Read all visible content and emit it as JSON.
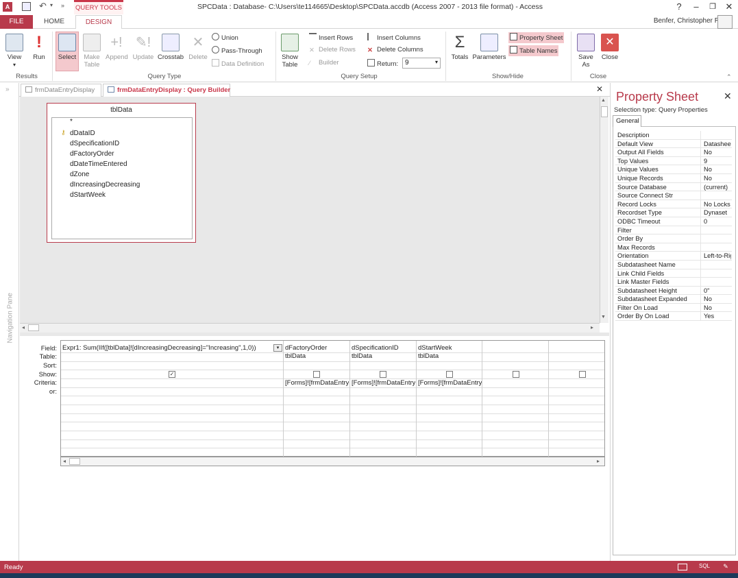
{
  "window": {
    "title": "SPCData : Database- C:\\Users\\te114665\\Desktop\\SPCData.accdb (Access 2007 - 2013 file format) - Access",
    "contextual_tab": "QUERY TOOLS",
    "user": "Benfer, Christopher R",
    "help": "?",
    "min": "–",
    "restore": "❐",
    "close": "✕"
  },
  "tabs": {
    "file": "FILE",
    "home": "HOME",
    "design": "DESIGN"
  },
  "ribbon": {
    "results": {
      "label": "Results",
      "view": "View",
      "run": "Run"
    },
    "query_type": {
      "label": "Query Type",
      "select": "Select",
      "make_table": "Make Table",
      "append": "Append",
      "update": "Update",
      "crosstab": "Crosstab",
      "delete": "Delete",
      "union": "Union",
      "pass_through": "Pass-Through",
      "data_definition": "Data Definition"
    },
    "query_setup": {
      "label": "Query Setup",
      "show_table": "Show Table",
      "insert_rows": "Insert Rows",
      "delete_rows": "Delete Rows",
      "builder": "Builder",
      "insert_columns": "Insert Columns",
      "delete_columns": "Delete Columns",
      "return_label": "Return:",
      "return_value": "9"
    },
    "show_hide": {
      "label": "Show/Hide",
      "totals": "Totals",
      "parameters": "Parameters",
      "property_sheet": "Property Sheet",
      "table_names": "Table Names"
    },
    "close": {
      "label": "Close",
      "save_as": "Save As",
      "close": "Close"
    }
  },
  "doc_tabs": [
    {
      "label": "frmDataEntryDisplay"
    },
    {
      "label": "frmDataEntryDisplay : Query Builder"
    }
  ],
  "nav_pane": {
    "label": "Navigation Pane"
  },
  "table": {
    "name": "tblData",
    "fields": [
      "*",
      "dDataID",
      "dSpecificationID",
      "dFactoryOrder",
      "dDateTimeEntered",
      "dZone",
      "dIncreasingDecreasing",
      "dStartWeek"
    ]
  },
  "grid": {
    "row_labels": [
      "Field:",
      "Table:",
      "Sort:",
      "Show:",
      "Criteria:",
      "or:"
    ],
    "columns": [
      {
        "field": "Expr1: Sum(IIf([tblData]![dIncreasingDecreasing]=\"Increasing\",1,0))",
        "table": "",
        "show": "✓",
        "criteria": ""
      },
      {
        "field": "dFactoryOrder",
        "table": "tblData",
        "show": "",
        "criteria": "[Forms]![frmDataEntry"
      },
      {
        "field": "dSpecificationID",
        "table": "tblData",
        "show": "",
        "criteria": "[Forms]![frmDataEntry"
      },
      {
        "field": "dStartWeek",
        "table": "tblData",
        "show": "",
        "criteria": "[Forms]![frmDataEntry"
      },
      {
        "field": "",
        "table": "",
        "show": "",
        "criteria": ""
      },
      {
        "field": "",
        "table": "",
        "show": "",
        "criteria": ""
      }
    ]
  },
  "property_sheet": {
    "title": "Property Sheet",
    "selection_type": "Selection type:  Query Properties",
    "tab": "General",
    "rows": [
      {
        "k": "Description",
        "v": ""
      },
      {
        "k": "Default View",
        "v": "Datasheet"
      },
      {
        "k": "Output All Fields",
        "v": "No"
      },
      {
        "k": "Top Values",
        "v": "9"
      },
      {
        "k": "Unique Values",
        "v": "No"
      },
      {
        "k": "Unique Records",
        "v": "No"
      },
      {
        "k": "Source Database",
        "v": "(current)"
      },
      {
        "k": "Source Connect Str",
        "v": ""
      },
      {
        "k": "Record Locks",
        "v": "No Locks"
      },
      {
        "k": "Recordset Type",
        "v": "Dynaset"
      },
      {
        "k": "ODBC Timeout",
        "v": "0"
      },
      {
        "k": "Filter",
        "v": ""
      },
      {
        "k": "Order By",
        "v": ""
      },
      {
        "k": "Max Records",
        "v": ""
      },
      {
        "k": "Orientation",
        "v": "Left-to-Right"
      },
      {
        "k": "Subdatasheet Name",
        "v": ""
      },
      {
        "k": "Link Child Fields",
        "v": ""
      },
      {
        "k": "Link Master Fields",
        "v": ""
      },
      {
        "k": "Subdatasheet Height",
        "v": "0\""
      },
      {
        "k": "Subdatasheet Expanded",
        "v": "No"
      },
      {
        "k": "Filter On Load",
        "v": "No"
      },
      {
        "k": "Order By On Load",
        "v": "Yes"
      }
    ]
  },
  "status": {
    "text": "Ready",
    "sql": "SQL"
  },
  "colors": {
    "accent": "#b83a4b",
    "selected": "#f4c9cd"
  }
}
